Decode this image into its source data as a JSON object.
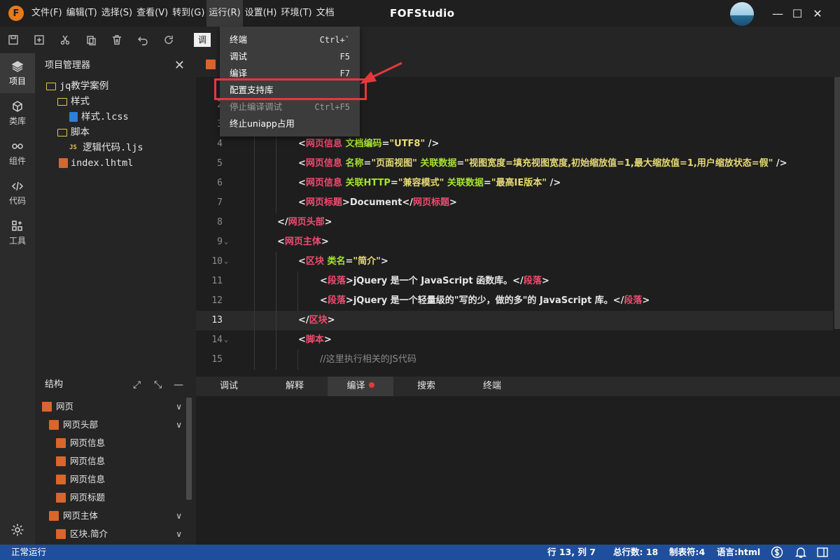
{
  "app": {
    "logo_letter": "F",
    "title": "FOFStudio",
    "menus": [
      "文件(F)",
      "编辑(T)",
      "选择(S)",
      "查看(V)",
      "转到(G)",
      "运行(R)",
      "设置(H)",
      "环境(T)",
      "文档"
    ],
    "window_controls": {
      "minimize": "—",
      "maximize": "☐",
      "close": "✕"
    }
  },
  "toolbar": {
    "buttons": [
      "save-icon",
      "new-file-icon",
      "cut-icon",
      "paste-icon",
      "delete-icon",
      "undo-icon",
      "redo-icon"
    ],
    "chip_label": "调"
  },
  "activity": {
    "items": [
      {
        "label": "项目",
        "icon": "layers-icon"
      },
      {
        "label": "类库",
        "icon": "cube-icon"
      },
      {
        "label": "组件",
        "icon": "link-icon"
      },
      {
        "label": "代码",
        "icon": "code-icon"
      },
      {
        "label": "工具",
        "icon": "tools-icon"
      }
    ],
    "settings_icon": "gear-icon"
  },
  "explorer": {
    "title": "项目管理器",
    "close": "✕",
    "tree": [
      {
        "label": "jq教学案例",
        "type": "folder"
      },
      {
        "label": "样式",
        "type": "folder"
      },
      {
        "label": "样式.lcss",
        "type": "css"
      },
      {
        "label": "脚本",
        "type": "folder"
      },
      {
        "label": "逻辑代码.ljs",
        "type": "js",
        "icon_text": "JS"
      },
      {
        "label": "index.lhtml",
        "type": "html"
      }
    ]
  },
  "structure": {
    "title": "结构",
    "expand": "⤢",
    "collapse": "⤡",
    "minimize": "—",
    "items": [
      {
        "label": "网页",
        "expandable": true
      },
      {
        "label": "网页头部",
        "expandable": true
      },
      {
        "label": "网页信息",
        "expandable": false
      },
      {
        "label": "网页信息",
        "expandable": false
      },
      {
        "label": "网页信息",
        "expandable": false
      },
      {
        "label": "网页标题",
        "expandable": false
      },
      {
        "label": "网页主体",
        "expandable": true
      },
      {
        "label": "区块.简介",
        "expandable": true
      }
    ]
  },
  "editor": {
    "current_line": 13,
    "lines": [
      {
        "n": "2"
      },
      {
        "n": "3"
      },
      {
        "n": "4",
        "parts": [
          [
            "br",
            "<"
          ],
          [
            "tg",
            "网页信息"
          ],
          [
            "at",
            " 文档编码"
          ],
          [
            "br",
            "="
          ],
          [
            "vl",
            "\"UTF8\""
          ],
          [
            "br",
            " />"
          ]
        ]
      },
      {
        "n": "5",
        "parts": [
          [
            "br",
            "<"
          ],
          [
            "tg",
            "网页信息"
          ],
          [
            "at",
            " 名称"
          ],
          [
            "br",
            "="
          ],
          [
            "vl",
            "\"页面视图\""
          ],
          [
            "at",
            " 关联数据"
          ],
          [
            "br",
            "="
          ],
          [
            "vl",
            "\"视图宽度=填充视图宽度,初始缩放值=1,最大缩放值=1,用户缩放状态=假\""
          ],
          [
            "br",
            " />"
          ]
        ]
      },
      {
        "n": "6",
        "parts": [
          [
            "br",
            "<"
          ],
          [
            "tg",
            "网页信息"
          ],
          [
            "at",
            " 关联HTTP"
          ],
          [
            "br",
            "="
          ],
          [
            "vl",
            "\"兼容模式\""
          ],
          [
            "at",
            " 关联数据"
          ],
          [
            "br",
            "="
          ],
          [
            "vl",
            "\"最高IE版本\""
          ],
          [
            "br",
            " />"
          ]
        ]
      },
      {
        "n": "7",
        "parts": [
          [
            "br",
            "<"
          ],
          [
            "tg",
            "网页标题"
          ],
          [
            "br",
            ">Document</"
          ],
          [
            "tg",
            "网页标题"
          ],
          [
            "br",
            ">"
          ]
        ]
      },
      {
        "n": "8",
        "parts": [
          [
            "br",
            "</"
          ],
          [
            "tg",
            "网页头部"
          ],
          [
            "br",
            ">"
          ]
        ]
      },
      {
        "n": "9",
        "parts": [
          [
            "br",
            "<"
          ],
          [
            "tg",
            "网页主体"
          ],
          [
            "br",
            ">"
          ]
        ]
      },
      {
        "n": "10",
        "parts": [
          [
            "br",
            "<"
          ],
          [
            "tg",
            "区块"
          ],
          [
            "at",
            " 类名"
          ],
          [
            "br",
            "="
          ],
          [
            "vl",
            "\"简介\""
          ],
          [
            "br",
            ">"
          ]
        ]
      },
      {
        "n": "11",
        "parts": [
          [
            "br",
            "<"
          ],
          [
            "tg",
            "段落"
          ],
          [
            "br",
            ">jQuery 是一个 JavaScript 函数库。</"
          ],
          [
            "tg",
            "段落"
          ],
          [
            "br",
            ">"
          ]
        ]
      },
      {
        "n": "12",
        "parts": [
          [
            "br",
            "<"
          ],
          [
            "tg",
            "段落"
          ],
          [
            "br",
            ">jQuery 是一个轻量级的\"写的少，做的多\"的 JavaScript 库。</"
          ],
          [
            "tg",
            "段落"
          ],
          [
            "br",
            ">"
          ]
        ]
      },
      {
        "n": "13",
        "parts": [
          [
            "br",
            "</"
          ],
          [
            "tg",
            "区块"
          ],
          [
            "br",
            ">"
          ]
        ]
      },
      {
        "n": "14",
        "parts": [
          [
            "br",
            "<"
          ],
          [
            "tg",
            "脚本"
          ],
          [
            "br",
            ">"
          ]
        ]
      },
      {
        "n": "15",
        "parts": [
          [
            "cm",
            "//这里执行相关的JS代码"
          ]
        ]
      }
    ]
  },
  "run_menu": {
    "items": [
      {
        "label": "终端",
        "shortcut": "Ctrl+`",
        "disabled": false
      },
      {
        "label": "调试",
        "shortcut": "F5",
        "disabled": false
      },
      {
        "label": "编译",
        "shortcut": "F7",
        "disabled": false
      },
      {
        "label": "配置支持库",
        "shortcut": "",
        "disabled": false,
        "highlighted": true
      },
      {
        "label": "停止编译调试",
        "shortcut": "Ctrl+F5",
        "disabled": true
      },
      {
        "label": "终止uniapp占用",
        "shortcut": "",
        "disabled": false
      }
    ]
  },
  "bottom_panel": {
    "tabs": [
      {
        "label": "调试",
        "active": false
      },
      {
        "label": "解释",
        "active": false
      },
      {
        "label": "编译",
        "active": true,
        "dot": true
      },
      {
        "label": "搜索",
        "active": false
      },
      {
        "label": "终端",
        "active": false
      }
    ]
  },
  "status": {
    "left": "正常运行",
    "position": "行 13, 列 7",
    "total_lines": "总行数: 18",
    "tab_size": "制表符:4",
    "language": "语言:html"
  }
}
